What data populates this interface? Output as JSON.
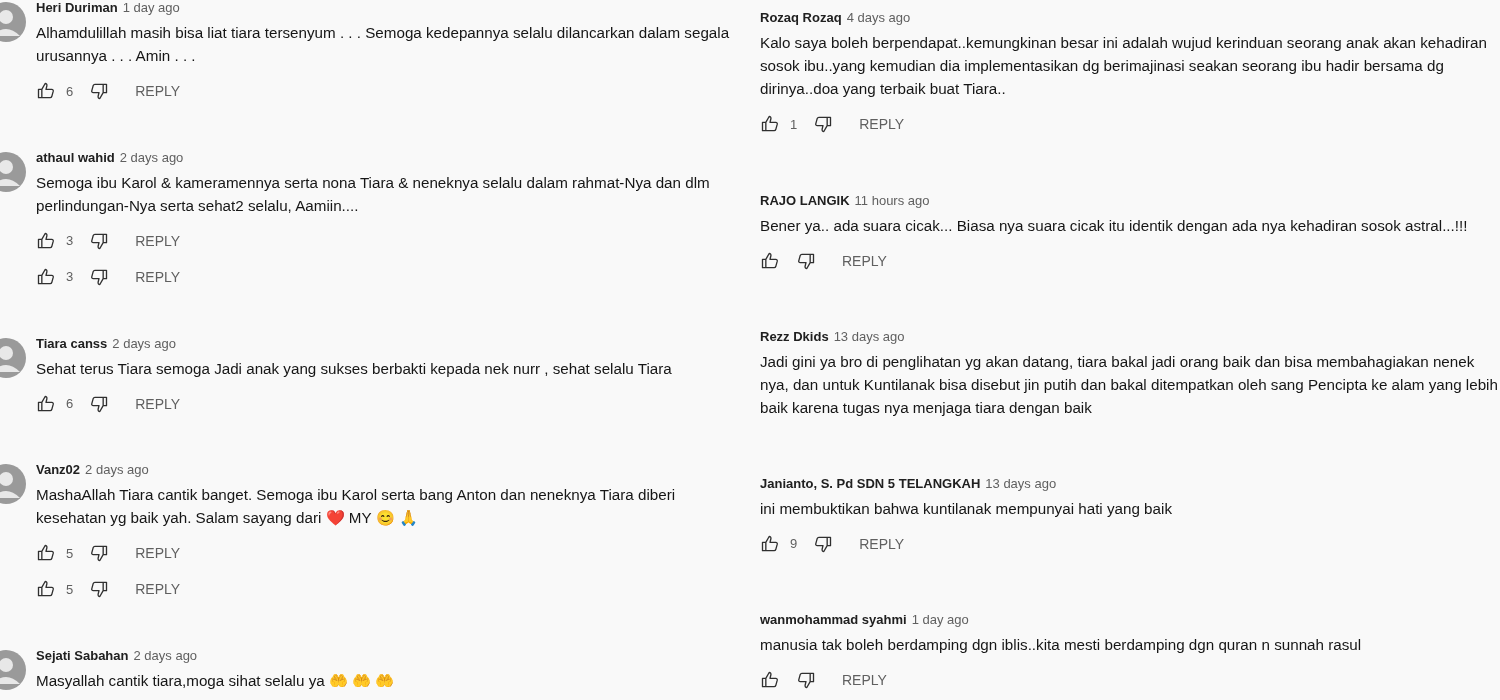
{
  "columns": [
    {
      "comments": [
        {
          "avatar": true,
          "author": "Heri Duriman",
          "time": "1 day ago",
          "text": "Alhamdulillah masih bisa liat tiara tersenyum . . . Semoga kedepannya selalu dilancarkan dalam segala urusannya . . . Amin . . .",
          "actions": [
            {
              "likes": "6",
              "reply": "REPLY"
            }
          ]
        },
        {
          "avatar": true,
          "author": "athaul wahid",
          "time": "2 days ago",
          "text": "Semoga ibu Karol & kameramennya serta nona Tiara & neneknya selalu dalam rahmat-Nya dan dlm perlindungan-Nya serta sehat2 selalu, Aamiin....",
          "actions": [
            {
              "likes": "3",
              "reply": "REPLY"
            },
            {
              "likes": "3",
              "reply": "REPLY"
            }
          ]
        },
        {
          "avatar": true,
          "author": "Tiara canss",
          "time": "2 days ago",
          "text": "Sehat terus Tiara semoga Jadi anak yang sukses berbakti kepada nek nurr ,  sehat selalu Tiara",
          "actions": [
            {
              "likes": "6",
              "reply": "REPLY"
            }
          ]
        },
        {
          "avatar": true,
          "author": "Vanz02",
          "time": "2 days ago",
          "text": "MashaAllah Tiara cantik banget. Semoga ibu Karol serta bang Anton dan neneknya Tiara diberi kesehatan yg baik yah. Salam sayang dari ❤️ MY 😊 🙏",
          "actions": [
            {
              "likes": "5",
              "reply": "REPLY"
            },
            {
              "likes": "5",
              "reply": "REPLY"
            }
          ]
        },
        {
          "avatar": true,
          "author": "Sejati Sabahan",
          "time": "2 days ago",
          "text": "Masyallah cantik tiara,moga sihat selalu ya 🤲 🤲 🤲"
        }
      ]
    },
    {
      "comments": [
        {
          "avatar": false,
          "author": "Rozaq Rozaq",
          "time": "4 days ago",
          "text": "Kalo saya boleh berpendapat..kemungkinan besar ini adalah wujud kerinduan seorang anak akan kehadiran sosok ibu..yang kemudian dia implementasikan dg berimajinasi seakan seorang ibu hadir bersama dg dirinya..doa yang terbaik buat Tiara..",
          "actions": [
            {
              "likes": "1",
              "reply": "REPLY"
            }
          ]
        },
        {
          "avatar": false,
          "author": "RAJO LANGIK",
          "time": "11 hours ago",
          "text": "Bener ya.. ada suara cicak... Biasa nya suara cicak itu identik dengan ada nya kehadiran sosok astral...!!!",
          "actions": [
            {
              "reply": "REPLY"
            }
          ]
        },
        {
          "avatar": false,
          "author": "Rezz Dkids",
          "time": "13 days ago",
          "text": "Jadi gini ya bro di penglihatan yg akan datang, tiara bakal jadi orang baik dan bisa membahagiakan nenek nya, dan untuk Kuntilanak bisa disebut jin putih dan bakal ditempatkan oleh sang Pencipta ke alam yang lebih baik karena tugas nya menjaga tiara dengan baik"
        },
        {
          "avatar": false,
          "author": "Janianto, S. Pd SDN 5 TELANGKAH",
          "time": "13 days ago",
          "text": "ini membuktikan bahwa kuntilanak mempunyai hati yang baik",
          "actions": [
            {
              "likes": "9",
              "reply": "REPLY"
            }
          ]
        },
        {
          "avatar": false,
          "author": "wanmohammad syahmi",
          "time": "1 day ago",
          "text": "manusia tak boleh berdamping dgn iblis..kita mesti berdamping dgn quran n sunnah rasul",
          "actions": [
            {
              "reply": "REPLY"
            }
          ]
        }
      ]
    }
  ]
}
